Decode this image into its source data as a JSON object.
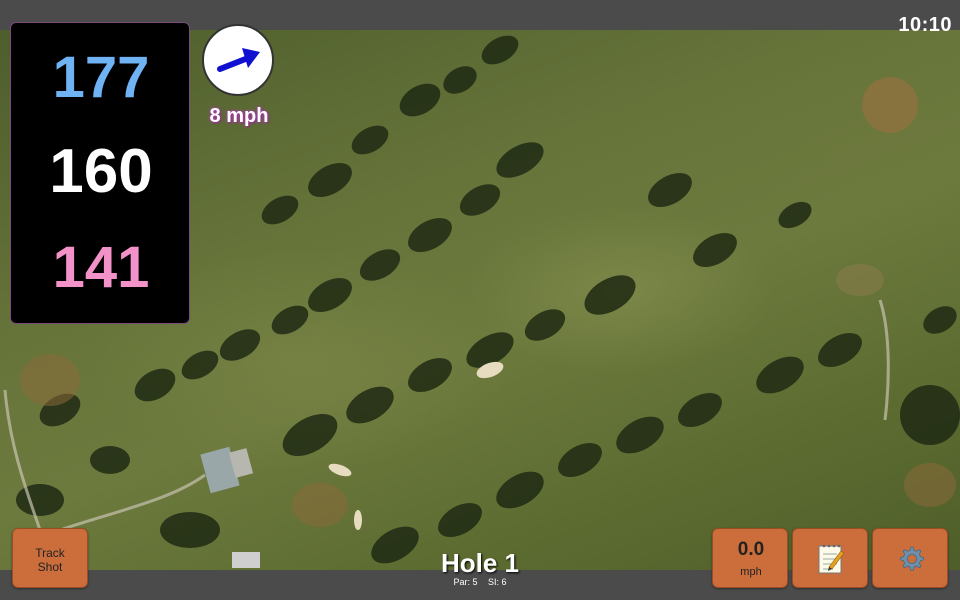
{
  "status": {
    "clock": "10:10"
  },
  "yardages": {
    "back": "177",
    "center": "160",
    "front": "141"
  },
  "wind": {
    "speed_label": "8 mph",
    "direction_icon": "wind-arrow-icon"
  },
  "hole": {
    "title": "Hole 1",
    "par_label": "Par: 5",
    "si_label": "SI: 6"
  },
  "buttons": {
    "track_shot_line1": "Track",
    "track_shot_line2": "Shot",
    "speed_value": "0.0",
    "speed_unit": "mph",
    "notes_icon": "notepad-icon",
    "settings_icon": "gear-icon"
  },
  "colors": {
    "back_yardage": "#6fb3f5",
    "center_yardage": "#ffffff",
    "front_yardage": "#f292c9",
    "button": "#cc6e3c",
    "wind_arrow": "#1010d0"
  }
}
